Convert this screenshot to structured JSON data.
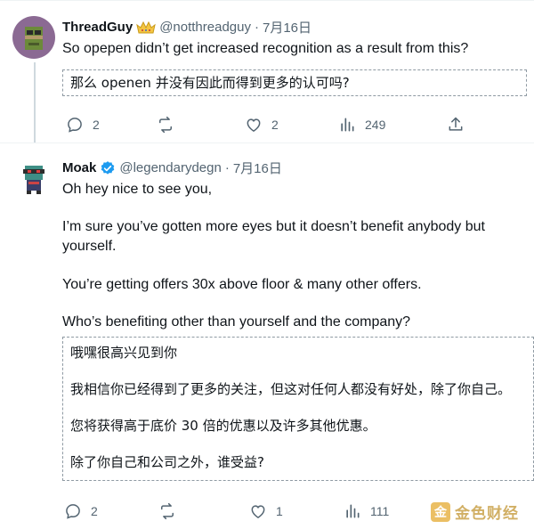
{
  "tweet1": {
    "name": "ThreadGuy",
    "handle": "@notthreadguy",
    "dot": "·",
    "time": "7月16日",
    "text": "So opepen didn’t get increased recognition as a result from this?",
    "translation": "那么 openen 并没有因此而得到更多的认可吗?",
    "replies": "2",
    "retweets": "",
    "likes": "2",
    "views": "249"
  },
  "tweet2": {
    "name": "Moak",
    "handle": "@legendarydegn",
    "dot": "·",
    "time": "7月16日",
    "paragraphs": [
      "Oh hey nice to see you,",
      "I’m sure you’ve gotten more eyes but it doesn’t benefit anybody but yourself.",
      "You’re getting offers 30x above floor & many other offers.",
      "Who’s benefiting other than yourself and the company?"
    ],
    "translation": [
      "哦嘿很高兴见到你",
      "我相信你已经得到了更多的关注，但这对任何人都没有好处，除了你自己。",
      "您将获得高于底价 30 倍的优惠以及许多其他优惠。",
      "除了你自己和公司之外，谁受益?"
    ],
    "replies": "2",
    "retweets": "",
    "likes": "1",
    "views": "111"
  },
  "watermark": {
    "logo": "金",
    "text": "金色财经"
  },
  "colors": {
    "text": "#0f1419",
    "secondary": "#536471",
    "verified": "#1d9bf0",
    "thread_line": "#cfd9de"
  },
  "icons": [
    "reply-icon",
    "retweet-icon",
    "like-icon",
    "views-icon",
    "share-icon",
    "verified-icon",
    "subscriber-badge-icon"
  ]
}
